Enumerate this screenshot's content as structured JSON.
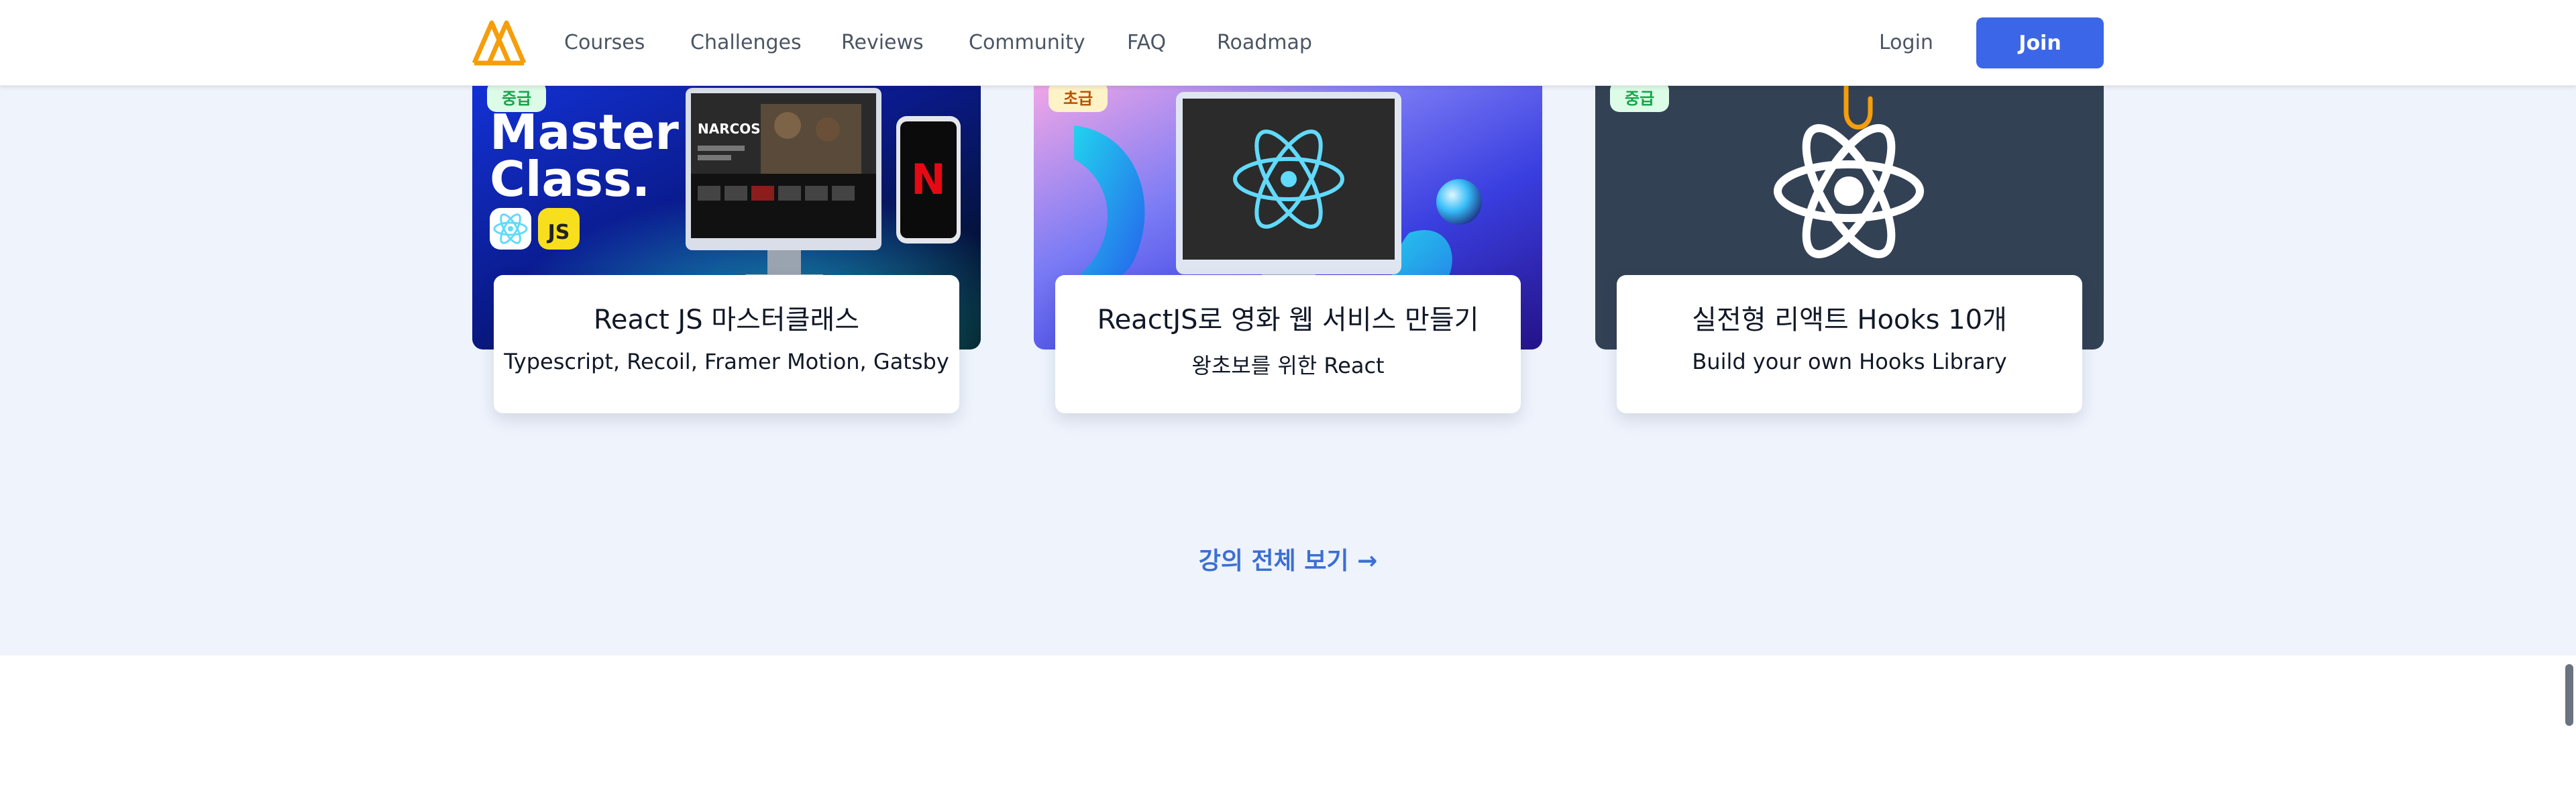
{
  "header": {
    "logo_icon": "nomad-m-logo-icon",
    "nav": [
      "Courses",
      "Challenges",
      "Reviews",
      "Community",
      "FAQ",
      "Roadmap"
    ],
    "login": "Login",
    "join": "Join"
  },
  "courses": [
    {
      "level": "중급",
      "title": "React JS 마스터클래스",
      "subtitle": "Typescript, Recoil, Framer Motion, Gatsby",
      "image": {
        "headline_line1": "Master",
        "headline_line2": "Class.",
        "badge_js": "JS",
        "show_title": "NARCOS",
        "phone_logo": "N"
      }
    },
    {
      "level": "초급",
      "title": "ReactJS로 영화 웹 서비스 만들기",
      "subtitle": "왕초보를 위한 React",
      "image": {}
    },
    {
      "level": "중급",
      "title": "실전형 리액트 Hooks 10개",
      "subtitle": "Build your own Hooks Library",
      "image": {}
    }
  ],
  "all_courses_link": "강의 전체 보기 →",
  "colors": {
    "accent": "#3b66e8",
    "section_bg": "#eef3fc",
    "link": "#3b6fd4",
    "logo": "#f59e0b"
  }
}
